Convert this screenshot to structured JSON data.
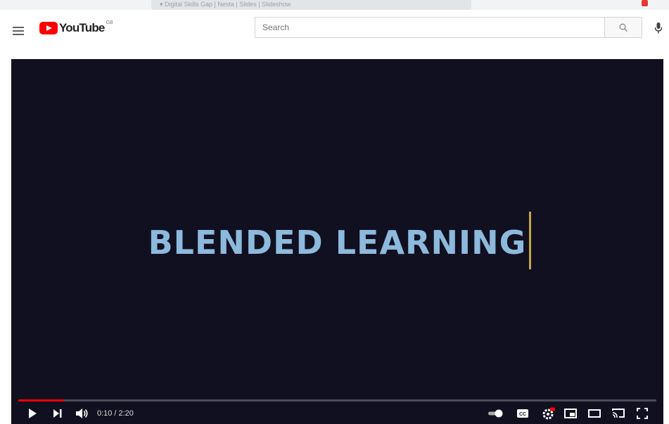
{
  "browser": {
    "tab_title": "▾ Digital Skills Gap | Nesta | Slides | Slideshow"
  },
  "masthead": {
    "logo_text": "YouTube",
    "country_code": "GB",
    "search_placeholder": "Search"
  },
  "player": {
    "video_title_text": "BLENDED LEARNING",
    "current_time": "0:10",
    "time_separator": "/",
    "duration": "2:20",
    "progress": 0.0714
  },
  "colors": {
    "brand_red": "#ff0000",
    "player_bg": "#101020",
    "title_text": "#8db9dc",
    "title_cursor": "#c8a84b"
  },
  "icons": {
    "menu": "hamburger-menu-icon",
    "search": "search-icon",
    "mic": "microphone-icon",
    "play": "play-icon",
    "next": "next-icon",
    "volume": "volume-icon",
    "autoplay": "autoplay-toggle-icon",
    "subtitles": "subtitles-icon",
    "settings": "settings-gear-icon",
    "miniplayer": "miniplayer-icon",
    "theater": "theater-mode-icon",
    "cast": "cast-icon",
    "fullscreen": "fullscreen-icon"
  }
}
